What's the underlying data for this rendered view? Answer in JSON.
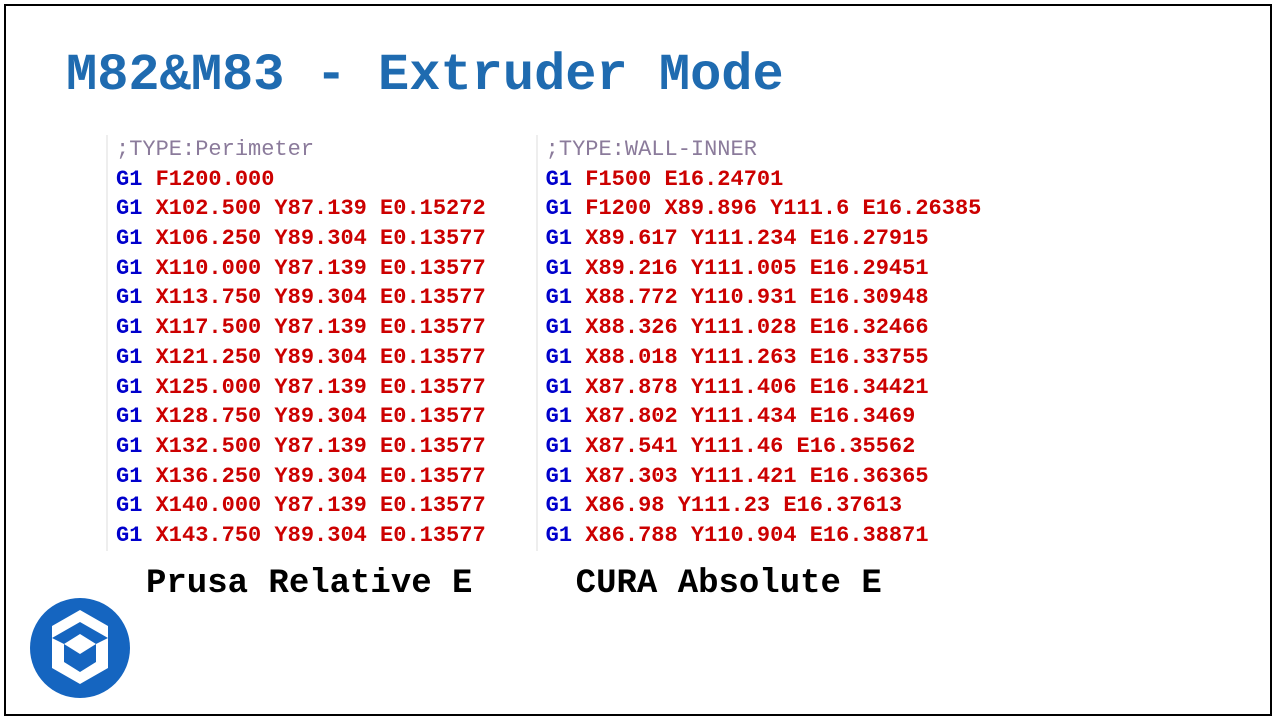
{
  "title": "M82&M83 - Extruder Mode",
  "left": {
    "caption": "Prusa Relative E",
    "comment": ";TYPE:Perimeter",
    "lines": [
      {
        "cmd": "G1",
        "rest": "F1200.000"
      },
      {
        "cmd": "G1",
        "rest": "X102.500 Y87.139 E0.15272"
      },
      {
        "cmd": "G1",
        "rest": "X106.250 Y89.304 E0.13577"
      },
      {
        "cmd": "G1",
        "rest": "X110.000 Y87.139 E0.13577"
      },
      {
        "cmd": "G1",
        "rest": "X113.750 Y89.304 E0.13577"
      },
      {
        "cmd": "G1",
        "rest": "X117.500 Y87.139 E0.13577"
      },
      {
        "cmd": "G1",
        "rest": "X121.250 Y89.304 E0.13577"
      },
      {
        "cmd": "G1",
        "rest": "X125.000 Y87.139 E0.13577"
      },
      {
        "cmd": "G1",
        "rest": "X128.750 Y89.304 E0.13577"
      },
      {
        "cmd": "G1",
        "rest": "X132.500 Y87.139 E0.13577"
      },
      {
        "cmd": "G1",
        "rest": "X136.250 Y89.304 E0.13577"
      },
      {
        "cmd": "G1",
        "rest": "X140.000 Y87.139 E0.13577"
      },
      {
        "cmd": "G1",
        "rest": "X143.750 Y89.304 E0.13577"
      }
    ]
  },
  "right": {
    "caption": "CURA Absolute E",
    "comment": ";TYPE:WALL-INNER",
    "lines": [
      {
        "cmd": "G1",
        "rest": "F1500 E16.24701"
      },
      {
        "cmd": "G1",
        "rest": "F1200   X89.896  Y111.6 E16.26385"
      },
      {
        "cmd": "G1",
        "rest": "X89.617  Y111.234 E16.27915"
      },
      {
        "cmd": "G1",
        "rest": "X89.216  Y111.005 E16.29451"
      },
      {
        "cmd": "G1",
        "rest": "X88.772  Y110.931 E16.30948"
      },
      {
        "cmd": "G1",
        "rest": "X88.326  Y111.028 E16.32466"
      },
      {
        "cmd": "G1",
        "rest": "X88.018  Y111.263 E16.33755"
      },
      {
        "cmd": "G1",
        "rest": "X87.878  Y111.406 E16.34421"
      },
      {
        "cmd": "G1",
        "rest": "X87.802  Y111.434 E16.3469"
      },
      {
        "cmd": "G1",
        "rest": "X87.541  Y111.46  E16.35562"
      },
      {
        "cmd": "G1",
        "rest": "X87.303  Y111.421 E16.36365"
      },
      {
        "cmd": "G1",
        "rest": "X86.98   Y111.23  E16.37613"
      },
      {
        "cmd": "G1",
        "rest": "X86.788  Y110.904 E16.38871"
      }
    ]
  }
}
